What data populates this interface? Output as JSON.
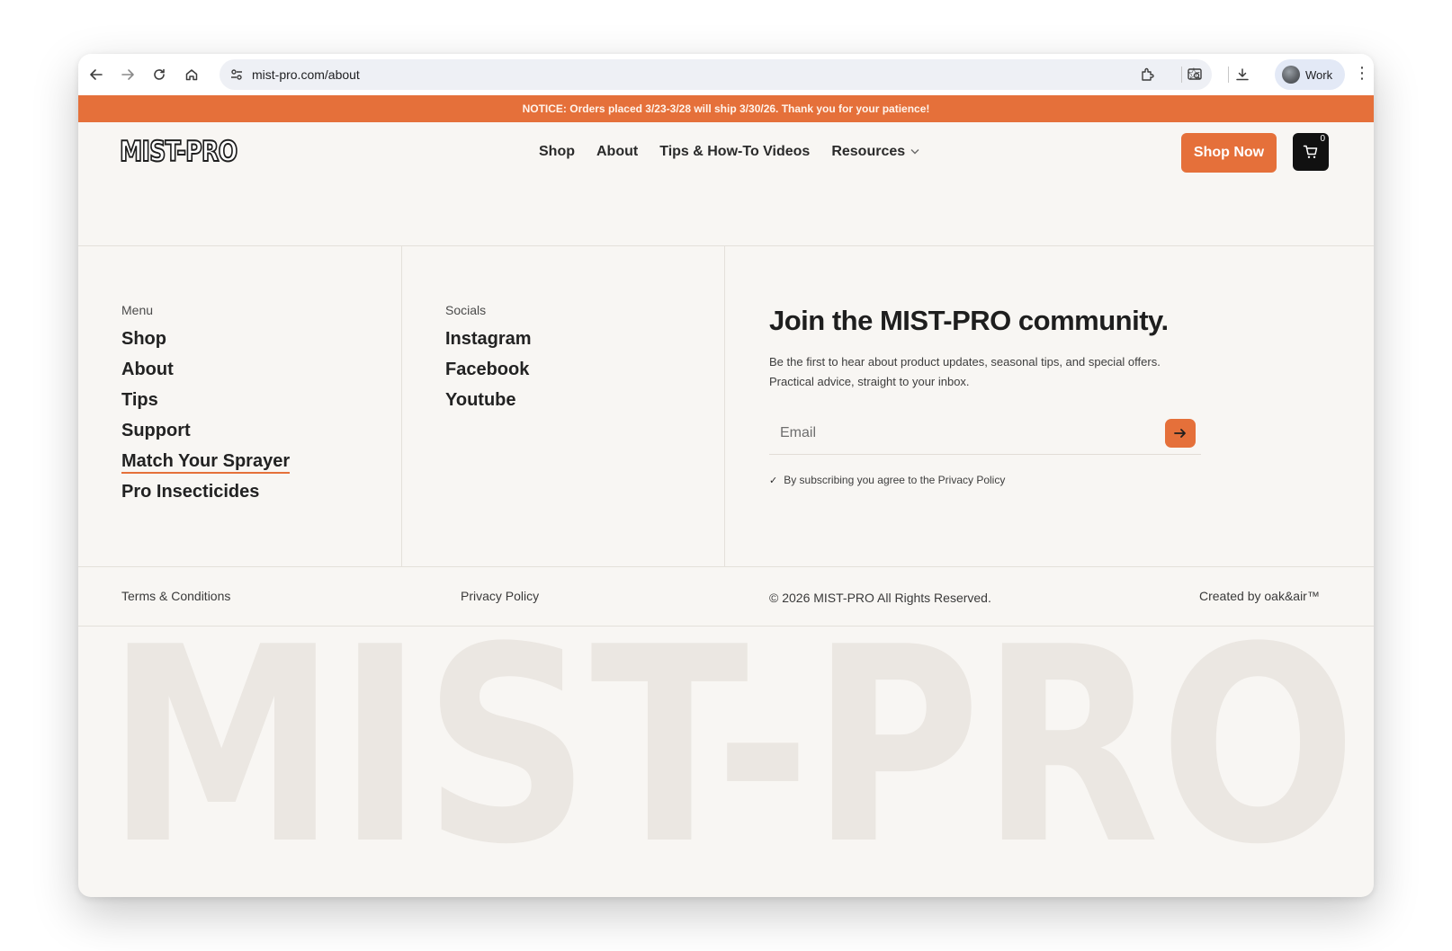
{
  "browser": {
    "url": "mist-pro.com/about",
    "profile_name": "Work"
  },
  "notice": {
    "text": "NOTICE: Orders placed 3/23-3/28 will ship 3/30/26. Thank you for your patience!"
  },
  "header": {
    "logo_text": "MIST-PRO",
    "nav": [
      {
        "label": "Shop"
      },
      {
        "label": "About"
      },
      {
        "label": "Tips & How-To Videos"
      },
      {
        "label": "Resources"
      }
    ],
    "shop_now_label": "Shop Now",
    "cart_count": "0"
  },
  "footer": {
    "menu_label": "Menu",
    "menu_items": [
      {
        "label": "Shop"
      },
      {
        "label": "About"
      },
      {
        "label": "Tips"
      },
      {
        "label": "Support"
      },
      {
        "label": "Match Your Sprayer"
      },
      {
        "label": "Pro Insecticides"
      }
    ],
    "socials_label": "Socials",
    "social_items": [
      {
        "label": "Instagram"
      },
      {
        "label": "Facebook"
      },
      {
        "label": "Youtube"
      }
    ],
    "join_title": "Join the MIST-PRO community.",
    "join_text": "Be the first to hear about product updates, seasonal tips, and special offers. Practical advice, straight to your inbox.",
    "email_placeholder": "Email",
    "agree_text": "By subscribing you agree to the Privacy Policy",
    "terms_label": "Terms & Conditions",
    "privacy_label": "Privacy Policy",
    "copyright": "© 2026 MIST-PRO All Rights Reserved.",
    "credit": "Created by oak&air™",
    "wordmark": "MIST-PRO"
  },
  "colors": {
    "accent": "#e5703a",
    "page_bg": "#f8f6f3",
    "text_dark": "#222222",
    "wordmark": "#ebe7e2"
  },
  "icons": [
    "back-arrow-icon",
    "forward-arrow-icon",
    "reload-icon",
    "home-icon",
    "site-settings-icon",
    "bookmark-star-icon",
    "extensions-icon",
    "tab-search-icon",
    "download-icon",
    "menu-dots-icon",
    "chevron-down-icon",
    "cart-icon",
    "arrow-right-icon",
    "checkmark-icon"
  ]
}
